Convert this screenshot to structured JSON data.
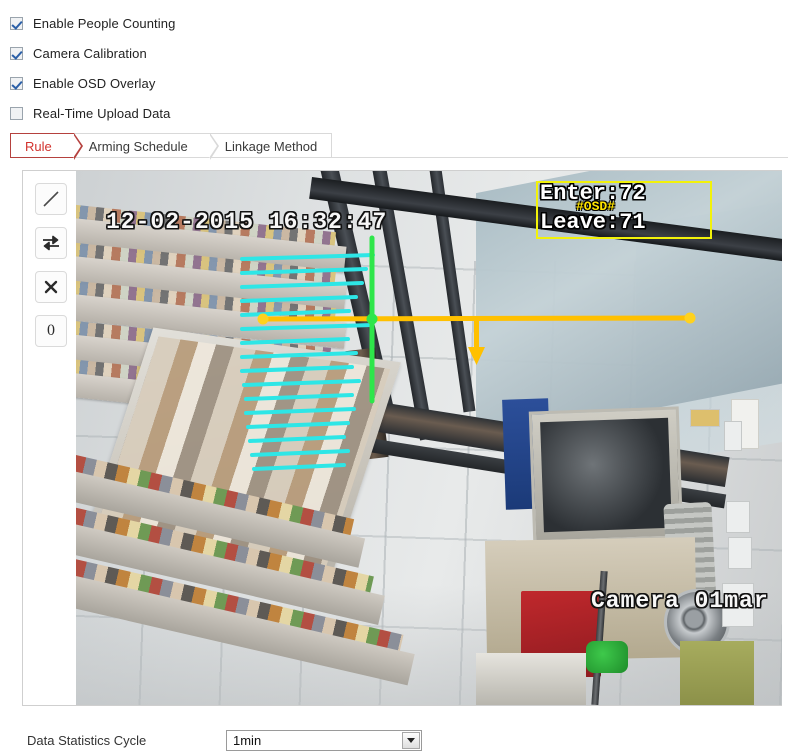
{
  "options": [
    {
      "label": "Enable People Counting",
      "checked": true,
      "name": "enable-people-counting"
    },
    {
      "label": "Camera Calibration",
      "checked": true,
      "name": "camera-calibration"
    },
    {
      "label": "Enable OSD Overlay",
      "checked": true,
      "name": "enable-osd-overlay"
    },
    {
      "label": "Real-Time Upload Data",
      "checked": false,
      "name": "real-time-upload-data"
    }
  ],
  "tabs": [
    {
      "label": "Rule",
      "active": true
    },
    {
      "label": "Arming Schedule",
      "active": false
    },
    {
      "label": "Linkage Method",
      "active": false
    }
  ],
  "toolbar": {
    "draw_line_icon": "diagonal-line-icon",
    "swap_direction_icon": "bidirectional-arrows-icon",
    "delete_icon": "cross-icon",
    "counter_label": "0"
  },
  "video": {
    "datetime": "12-02-2015 16:32:47",
    "camera_name": "Camera 01mar",
    "osd": {
      "enter_label": "Enter:72",
      "leave_label": "Leave:71",
      "tag": "#OSD#",
      "box_color": "#f2f20a",
      "tag_color": "#ffe400"
    },
    "rule_line": {
      "color": "#ffc000",
      "direction_arrow": "down",
      "endpoint_color": "#ffd21e"
    },
    "calibration": {
      "horizontal_line_color": "#2ee6e6",
      "vertical_line_color": "#2ee64a",
      "horizontal_line_count": 16
    }
  },
  "bottom": {
    "cycle_label": "Data Statistics Cycle",
    "cycle_value": "1min"
  }
}
